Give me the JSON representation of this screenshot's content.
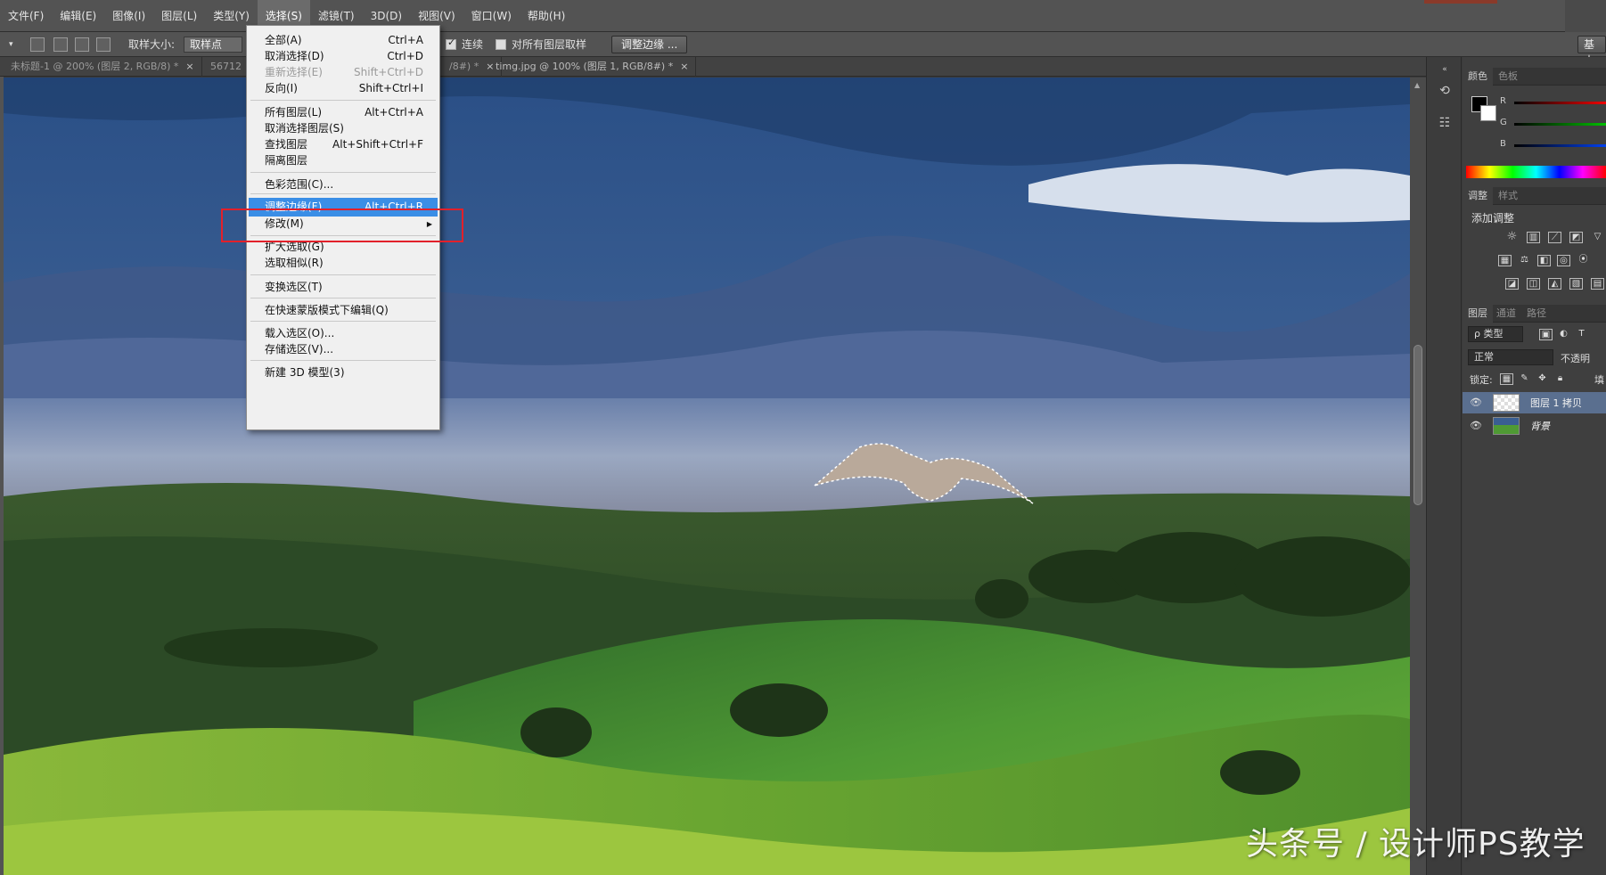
{
  "menubar": {
    "items": [
      "文件(F)",
      "编辑(E)",
      "图像(I)",
      "图层(L)",
      "类型(Y)",
      "选择(S)",
      "滤镜(T)",
      "3D(D)",
      "视图(V)",
      "窗口(W)",
      "帮助(H)"
    ],
    "active_index": 5
  },
  "options": {
    "sample_size_label": "取样大小:",
    "sample_size_value": "取样点",
    "contiguous_label": "连续",
    "all_layers_label": "对所有图层取样",
    "refine_edge_button": "调整边缘 ...",
    "workspace": "基本"
  },
  "tabs": [
    {
      "label": "未标题-1 @ 200% (图层 2, RGB/8) *"
    },
    {
      "label": "56712"
    },
    {
      "label": "/8#) *"
    },
    {
      "label": "timg.jpg @ 100% (图层 1, RGB/8#) *"
    }
  ],
  "select_menu": {
    "items": [
      {
        "label": "全部(A)",
        "shortcut": "Ctrl+A",
        "disabled": false
      },
      {
        "label": "取消选择(D)",
        "shortcut": "Ctrl+D",
        "disabled": false
      },
      {
        "label": "重新选择(E)",
        "shortcut": "Shift+Ctrl+D",
        "disabled": true
      },
      {
        "label": "反向(I)",
        "shortcut": "Shift+Ctrl+I",
        "disabled": false
      },
      {
        "label": "所有图层(L)",
        "shortcut": "Alt+Ctrl+A",
        "disabled": false
      },
      {
        "label": "取消选择图层(S)",
        "shortcut": "",
        "disabled": false
      },
      {
        "label": "查找图层",
        "shortcut": "Alt+Shift+Ctrl+F",
        "disabled": false
      },
      {
        "label": "隔离图层",
        "shortcut": "",
        "disabled": false
      },
      {
        "label": "色彩范围(C)...",
        "shortcut": "",
        "disabled": false
      },
      {
        "label": "调整边缘(F)...",
        "shortcut": "Alt+Ctrl+R",
        "disabled": false,
        "highlighted": true
      },
      {
        "label": "修改(M)",
        "shortcut": "",
        "disabled": false,
        "submenu": true
      },
      {
        "label": "扩大选取(G)",
        "shortcut": "",
        "disabled": false
      },
      {
        "label": "选取相似(R)",
        "shortcut": "",
        "disabled": false
      },
      {
        "label": "变换选区(T)",
        "shortcut": "",
        "disabled": false
      },
      {
        "label": "在快速蒙版模式下编辑(Q)",
        "shortcut": "",
        "disabled": false
      },
      {
        "label": "载入选区(O)...",
        "shortcut": "",
        "disabled": false
      },
      {
        "label": "存储选区(V)...",
        "shortcut": "",
        "disabled": false
      },
      {
        "label": "新建 3D 模型(3)",
        "shortcut": "",
        "disabled": false
      }
    ]
  },
  "color_panel": {
    "tabs": [
      "颜色",
      "色板"
    ],
    "channels": [
      "R",
      "G",
      "B"
    ],
    "foreground": "#000000",
    "background": "#ffffff"
  },
  "adjust_panel": {
    "tabs": [
      "调整",
      "样式"
    ],
    "title": "添加调整"
  },
  "layers_panel": {
    "tabs": [
      "图层",
      "通道",
      "路径"
    ],
    "filter": "ρ 类型",
    "blend_mode": "正常",
    "opacity_label": "不透明",
    "lock_label": "锁定:",
    "fill_label": "填",
    "layers": [
      {
        "name": "图层 1 拷贝",
        "selected": true
      },
      {
        "name": "背景",
        "selected": false
      }
    ]
  },
  "watermark": "头条号 / 设计师PS教学",
  "colors": {
    "menu_highlight": "#3a8ee6",
    "annotation_box": "#e2202a"
  }
}
